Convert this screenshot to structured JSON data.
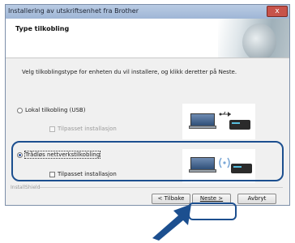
{
  "window": {
    "title": "Installering av utskriftsenhet fra Brother",
    "close_glyph": "x"
  },
  "header": {
    "title": "Type tilkobling"
  },
  "instruction": "Velg tilkoblingstype for enheten du vil installere, og klikk deretter på Neste.",
  "options": [
    {
      "label": "Lokal tilkobling (USB)",
      "selected": false,
      "custom_install": {
        "label": "Tilpasset installasjon",
        "checked": false,
        "enabled": false
      }
    },
    {
      "label": "Trådløs nettverkstilkobling",
      "selected": true,
      "custom_install": {
        "label": "Tilpasset installasjon",
        "checked": false,
        "enabled": true
      }
    }
  ],
  "footer": {
    "installshield": "InstallShield",
    "back_label": "< Tilbake",
    "next_label": "Neste >",
    "cancel_label": "Avbryt"
  },
  "colors": {
    "highlight": "#1c4f8f",
    "arrow": "#1c4f8f",
    "titlebar": "#a9bfdc"
  }
}
